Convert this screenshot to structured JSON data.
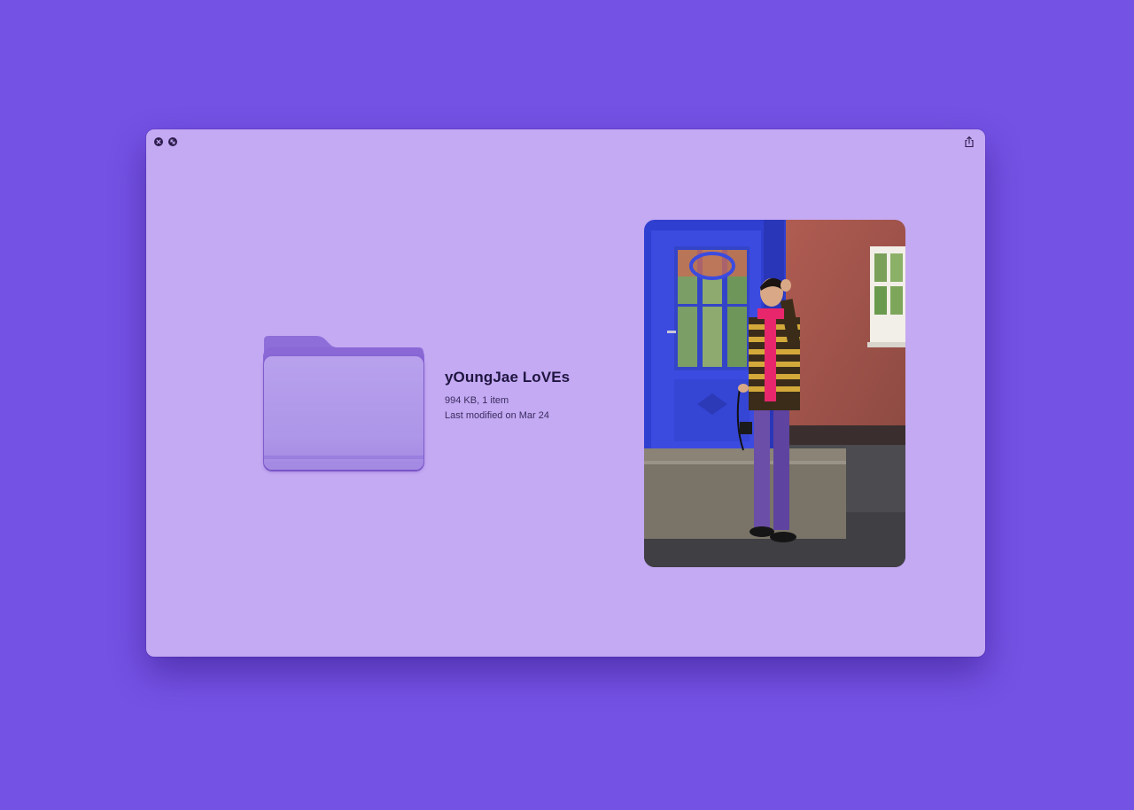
{
  "window": {
    "controls": {
      "close_icon": "close-icon",
      "fullscreen_icon": "fullscreen-icon"
    },
    "share_icon": "share-icon"
  },
  "item": {
    "name": "yOungJae LoVEs",
    "size_info": "994 KB, 1 item",
    "modified": "Last modified on Mar 24"
  },
  "colors": {
    "background": "#7452e4",
    "window": "#c4a9f3",
    "folder": "#ae96e8",
    "text": "#1f1640"
  }
}
